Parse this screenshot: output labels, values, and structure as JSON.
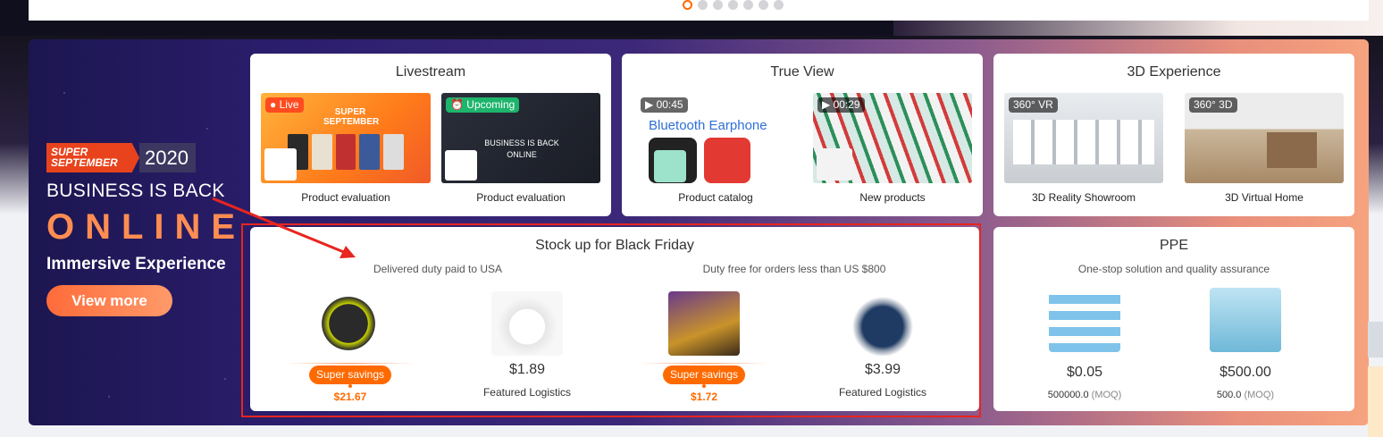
{
  "carousel": {
    "dot_count": 7,
    "active_index": 0
  },
  "promo": {
    "badge_tag_line1": "SUPER",
    "badge_tag_line2": "SEPTEMBER",
    "badge_year": "2020",
    "line1": "BUSINESS IS BACK",
    "line2": "ONLINE",
    "line3": "Immersive Experience",
    "button": "View more"
  },
  "livestream": {
    "title": "Livestream",
    "items": [
      {
        "badge": "Live",
        "caption": "Product evaluation",
        "thumb_text": "SUPER SEPTEMBER"
      },
      {
        "badge": "Upcoming",
        "caption": "Product evaluation",
        "thumb_text": "BUSINESS IS BACK ONLINE"
      }
    ]
  },
  "true_view": {
    "title": "True View",
    "items": [
      {
        "duration": "00:45",
        "caption": "Product catalog",
        "thumb_text": "Bluetooth Earphone"
      },
      {
        "duration": "00:29",
        "caption": "New products"
      }
    ]
  },
  "experience_3d": {
    "title": "3D Experience",
    "items": [
      {
        "badge": "VR",
        "caption": "3D Reality Showroom"
      },
      {
        "badge": "3D",
        "caption": "3D Virtual Home"
      }
    ]
  },
  "black_friday": {
    "title": "Stock up for Black Friday",
    "subtitle_left": "Delivered duty paid to USA",
    "subtitle_right": "Duty free for orders less than US $800",
    "products": [
      {
        "type": "saving",
        "saving_label": "Super savings",
        "price": "$21.67"
      },
      {
        "type": "logistics",
        "price": "$1.89",
        "label": "Featured Logistics"
      },
      {
        "type": "saving",
        "saving_label": "Super savings",
        "price": "$1.72"
      },
      {
        "type": "logistics",
        "price": "$3.99",
        "label": "Featured Logistics"
      }
    ]
  },
  "ppe": {
    "title": "PPE",
    "subtitle": "One-stop solution and quality assurance",
    "products": [
      {
        "price": "$0.05",
        "moq_value": "500000.0",
        "moq_unit": "(MOQ)"
      },
      {
        "price": "$500.00",
        "moq_value": "500.0",
        "moq_unit": "(MOQ)"
      }
    ]
  },
  "colors": {
    "accent": "#ff6a00",
    "highlight_box": "#e8251f"
  }
}
